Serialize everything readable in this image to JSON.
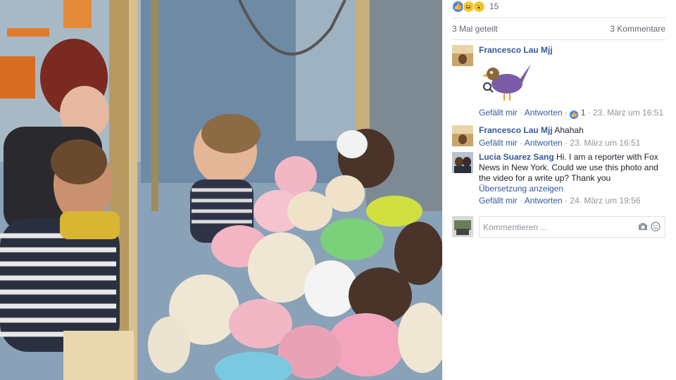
{
  "reactions": {
    "count": "15",
    "types": [
      "like-icon",
      "haha-icon",
      "wow-icon"
    ]
  },
  "summary": {
    "shares": "3 Mal geteilt",
    "comments": "3 Kommentare"
  },
  "comments": [
    {
      "author": "Francesco Lau Mjj",
      "text": "",
      "sticker": "bird-sticker",
      "like": "Gefällt mir",
      "reply": "Antworten",
      "likes": "1",
      "time": "23. März um 16:51"
    },
    {
      "author": "Francesco Lau Mjj",
      "text": "Ahahah",
      "like": "Gefällt mir",
      "reply": "Antworten",
      "time": "23. März um 16:51"
    },
    {
      "author": "Lucia Suarez Sang",
      "text": "Hi. I am a reporter with Fox News in New York. Could we use this photo and the video for a write up? Thank you",
      "translate": "Übersetzung anzeigen",
      "like": "Gefällt mir",
      "reply": "Antworten",
      "time": "24. März um 19:56"
    }
  ],
  "composer": {
    "placeholder": "Kommentieren ...",
    "icons": [
      "camera-icon",
      "emoji-icon"
    ]
  },
  "sep": " · "
}
